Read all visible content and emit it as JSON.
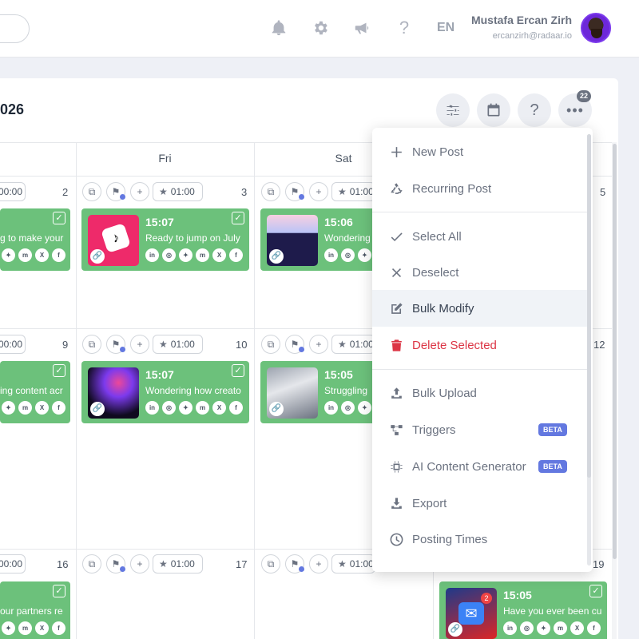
{
  "header": {
    "user_name": "Mustafa Ercan Zirh",
    "user_email": "ercanzirh@radaar.io",
    "language": "EN",
    "icons": [
      "bell-icon",
      "gear-icon",
      "megaphone-icon",
      "question-icon"
    ]
  },
  "calendar": {
    "title": "026",
    "more_badge": "22",
    "days": {
      "fri": "Fri",
      "sat": "Sat"
    },
    "week1": {
      "n_left": "2",
      "n_fri": "3",
      "n_right": "5",
      "time_left": "00:00",
      "time_fri": "01:00",
      "time_sat": "01:00"
    },
    "week2": {
      "n_left": "9",
      "n_fri": "10",
      "n_right": "12",
      "time_left": "00:00",
      "time_fri": "01:00",
      "time_sat": "01:00"
    },
    "week3": {
      "n_left": "16",
      "n_fri": "17",
      "n_right": "19",
      "time_left": "00:00",
      "time_fri": "01:00",
      "time_sat": "01:00"
    },
    "posts": {
      "w1_left": {
        "text": "g to make your"
      },
      "w1_fri": {
        "time": "15:07",
        "text": "Ready to jump on July"
      },
      "w1_sat": {
        "time": "15:06",
        "text": "Wondering"
      },
      "w2_left": {
        "text": "ing content acr"
      },
      "w2_fri": {
        "time": "15:07",
        "text": "Wondering how creato"
      },
      "w2_sat": {
        "time": "15:05",
        "text": "Struggling"
      },
      "w3_left": {
        "text": "our partners re"
      },
      "w3_right": {
        "time": "15:05",
        "text": "Have you ever been cu",
        "notif": "2"
      }
    },
    "social_labels": {
      "linkedin": "in",
      "instagram": "◎",
      "bluesky": "🦋",
      "mastodon": "m",
      "x": "X",
      "facebook": "f"
    }
  },
  "menu": {
    "new_post": "New Post",
    "recurring_post": "Recurring Post",
    "select_all": "Select All",
    "deselect": "Deselect",
    "bulk_modify": "Bulk Modify",
    "delete_selected": "Delete Selected",
    "bulk_upload": "Bulk Upload",
    "triggers": "Triggers",
    "ai_content_generator": "AI Content Generator",
    "export": "Export",
    "posting_times": "Posting Times",
    "beta": "BETA"
  },
  "colors": {
    "card_green": "#6cc17b",
    "accent_blue": "#6378e0",
    "danger": "#dc3545"
  }
}
